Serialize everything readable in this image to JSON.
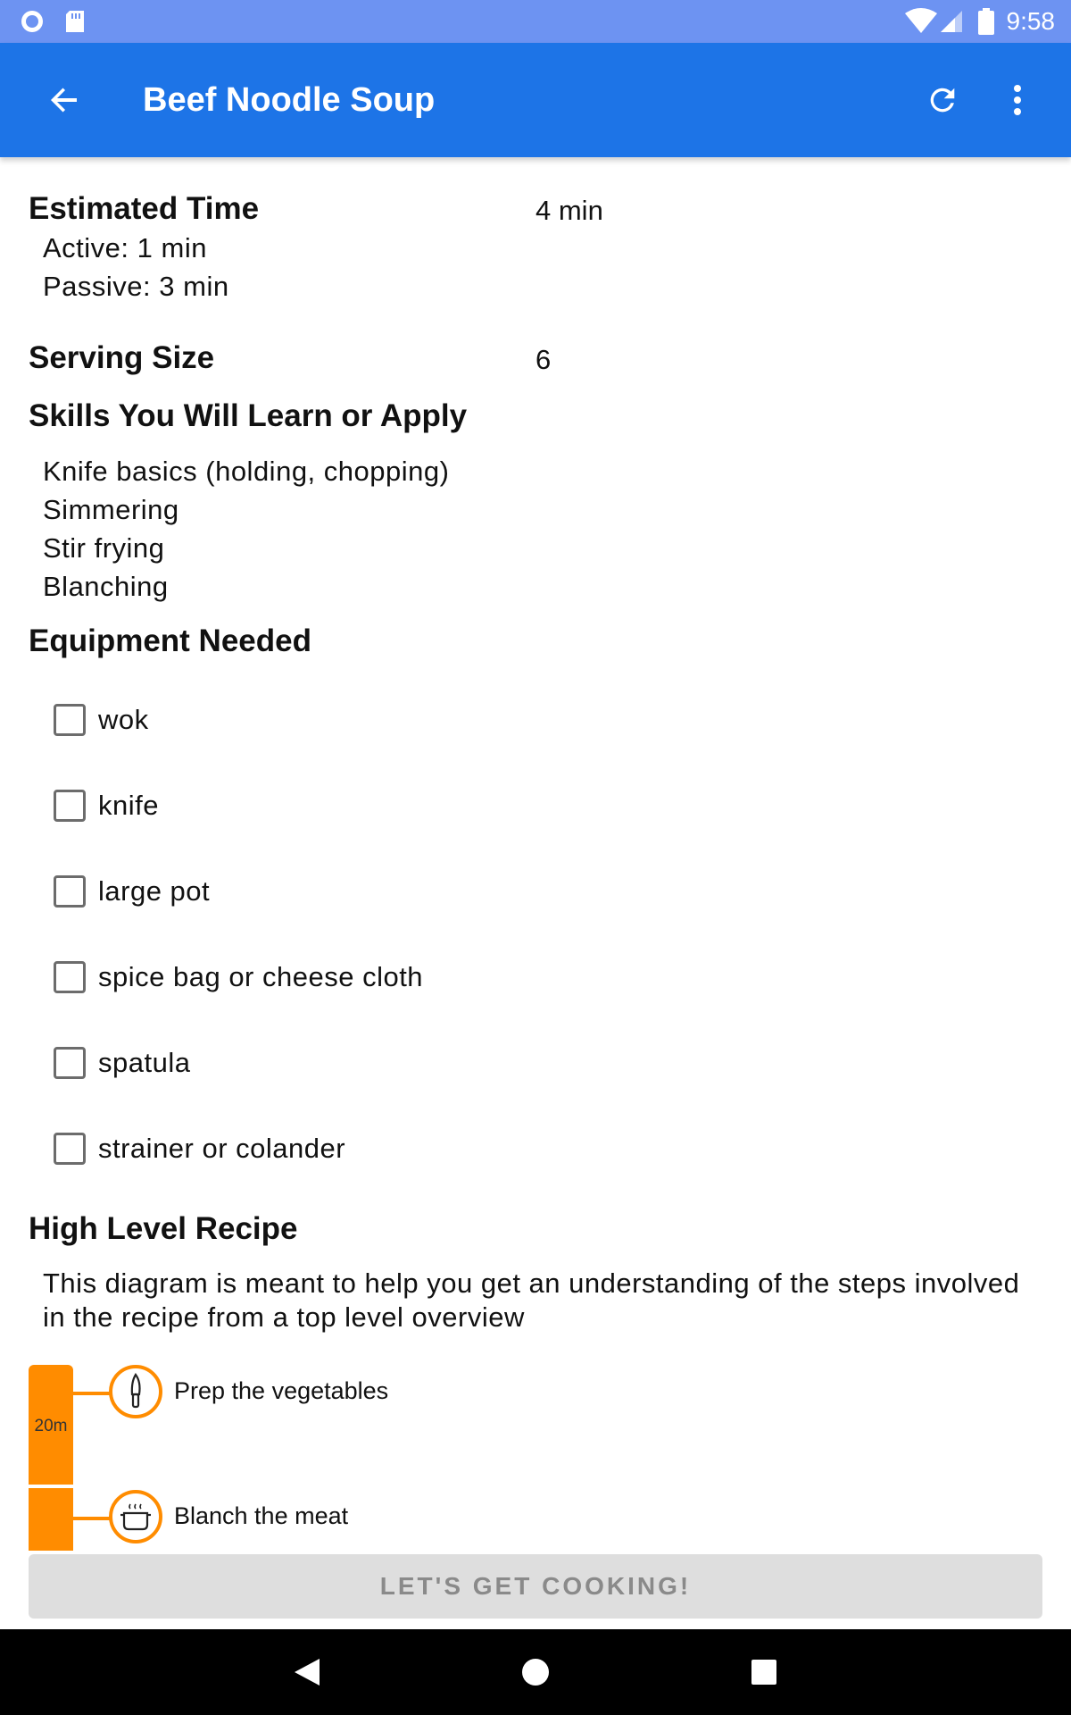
{
  "status_bar": {
    "time": "9:58",
    "icons": [
      "record-icon",
      "sd-card-icon",
      "wifi-icon",
      "signal-icon",
      "battery-icon"
    ]
  },
  "app_bar": {
    "title": "Beef Noodle Soup",
    "back_icon": "arrow-back-icon",
    "refresh_icon": "refresh-icon",
    "more_icon": "more-vert-icon",
    "color": "#1d74e7"
  },
  "estimated_time": {
    "heading": "Estimated Time",
    "total": "4 min",
    "active": "Active: 1 min",
    "passive": "Passive: 3 min"
  },
  "serving_size": {
    "heading": "Serving Size",
    "value": "6"
  },
  "skills": {
    "heading": "Skills You Will Learn or Apply",
    "items": [
      "Knife basics (holding, chopping)",
      "Simmering",
      "Stir frying",
      "Blanching"
    ]
  },
  "equipment": {
    "heading": "Equipment Needed",
    "items": [
      {
        "label": "wok",
        "checked": false
      },
      {
        "label": "knife",
        "checked": false
      },
      {
        "label": "large pot",
        "checked": false
      },
      {
        "label": "spice bag or cheese cloth",
        "checked": false
      },
      {
        "label": "spatula",
        "checked": false
      },
      {
        "label": "strainer or colander",
        "checked": false
      }
    ]
  },
  "high_level_recipe": {
    "heading": "High Level Recipe",
    "description": "This diagram is meant to help you get an understanding of the steps involved in the recipe from a top level overview",
    "duration_label": "20m",
    "accent_color": "#ff8c00",
    "steps": [
      {
        "label": "Prep the vegetables",
        "icon": "knife-icon"
      },
      {
        "label": "Blanch the meat",
        "icon": "steaming-pot-icon"
      }
    ]
  },
  "action_button": {
    "label": "LET'S GET COOKING!"
  },
  "nav_bar": {
    "icons": [
      "nav-back-icon",
      "nav-home-icon",
      "nav-recents-icon"
    ]
  }
}
